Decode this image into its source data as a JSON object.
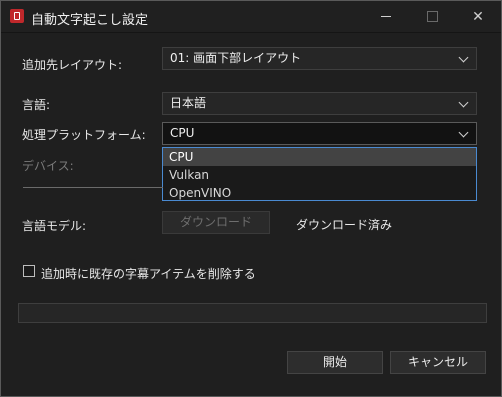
{
  "window": {
    "title": "自動文字起こし設定",
    "controls": {
      "minimize": "minimize",
      "maximize": "maximize",
      "close": "✕"
    }
  },
  "fields": {
    "target_layout": {
      "label": "追加先レイアウト:",
      "value": "01: 画面下部レイアウト"
    },
    "language": {
      "label": "言語:",
      "value": "日本語"
    },
    "platform": {
      "label": "処理プラットフォーム:",
      "value": "CPU",
      "options": [
        "CPU",
        "Vulkan",
        "OpenVINO"
      ],
      "selected_index": 0
    },
    "device": {
      "label": "デバイス:",
      "disabled": true
    },
    "model": {
      "label": "言語モデル:",
      "download_button": "ダウンロード",
      "status": "ダウンロード済み"
    }
  },
  "checkbox": {
    "label": "追加時に既存の字幕アイテムを削除する",
    "checked": false
  },
  "progress": {
    "value": 0
  },
  "buttons": {
    "start": "開始",
    "cancel": "キャンセル"
  },
  "colors": {
    "background": "#1f1f1f",
    "dropdown_border": "#4a8ad1",
    "selected_option": "#434343"
  }
}
